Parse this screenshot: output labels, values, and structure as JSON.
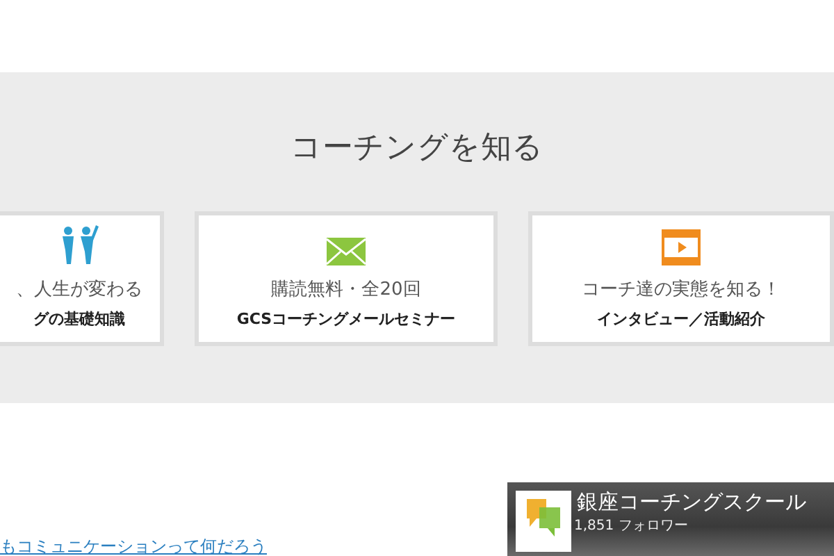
{
  "section": {
    "title": "コーチングを知る",
    "cards": [
      {
        "kind": "people",
        "line1": "、人生が変わる",
        "line2": "グの基礎知識"
      },
      {
        "kind": "mail",
        "line1": "購読無料・全20回",
        "line2": "GCSコーチングメールセミナー"
      },
      {
        "kind": "video",
        "line1": "コーチ達の実態を知る！",
        "line2": "インタビュー／活動紹介"
      }
    ]
  },
  "link": "もコミュニケーションって何だろう",
  "social": {
    "name": "銀座コーチングスクール",
    "followers": "1,851 フォロワー"
  }
}
